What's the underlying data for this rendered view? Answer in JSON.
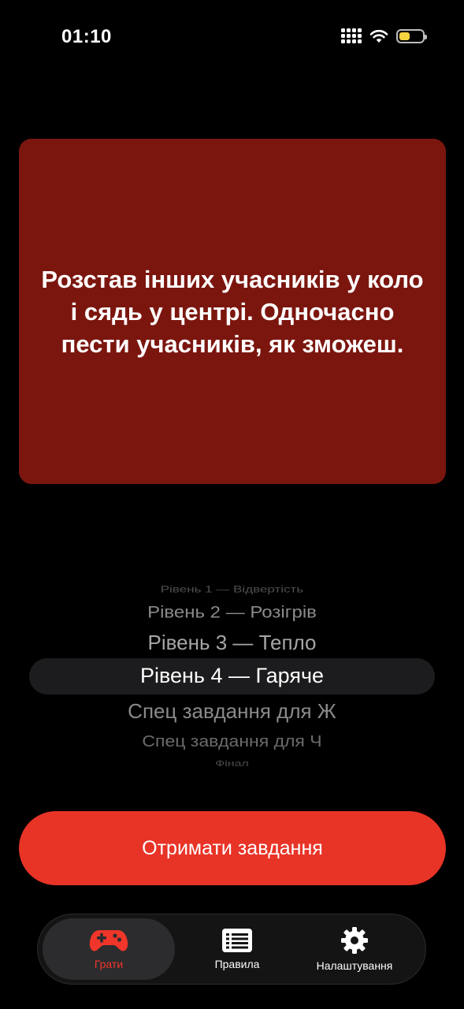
{
  "status_bar": {
    "time": "01:10"
  },
  "task_card": {
    "text": "Розстав інших учасників у коло і сядь у центрі. Одночасно пести учасників, як зможеш."
  },
  "level_picker": {
    "options": [
      "Рівень 1 — Відвертість",
      "Рівень 2 — Розігрів",
      "Рівень 3 — Тепло",
      "Рівень 4 — Гаряче",
      "Спец завдання для Ж",
      "Спец завдання для Ч",
      "Фінал"
    ],
    "selected": "Рівень 4 — Гаряче"
  },
  "cta": {
    "label": "Отримати завдання"
  },
  "tabbar": {
    "tabs": [
      {
        "label": "Грати",
        "icon": "gamepad-icon",
        "active": true
      },
      {
        "label": "Правила",
        "icon": "list-icon",
        "active": false
      },
      {
        "label": "Налаштування",
        "icon": "gear-icon",
        "active": false
      }
    ]
  },
  "colors": {
    "card_bg": "#7b160f",
    "accent": "#e83427",
    "active_tab_label": "#f0362a",
    "battery": "#f5d442"
  }
}
